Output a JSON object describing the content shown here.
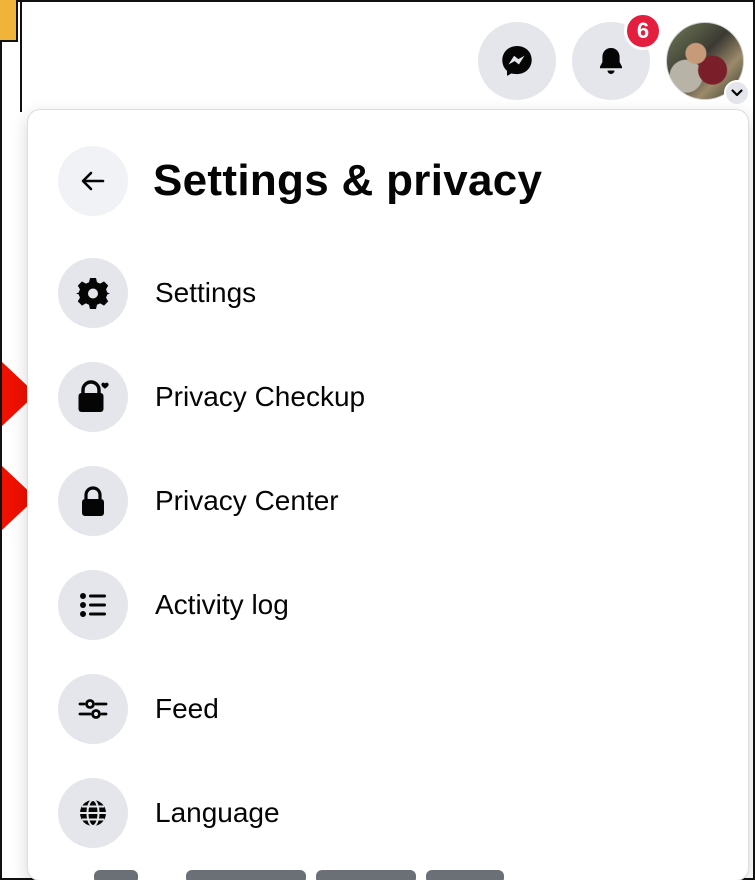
{
  "header": {
    "notification_count": "6",
    "buttons": [
      {
        "name": "messenger",
        "icon": "messenger-icon"
      },
      {
        "name": "notifications",
        "icon": "bell-icon"
      },
      {
        "name": "account",
        "icon": "chevron-down-icon"
      }
    ]
  },
  "panel": {
    "title": "Settings & privacy",
    "back_icon": "arrow-left-icon",
    "items": [
      {
        "label": "Settings",
        "icon": "gear-icon"
      },
      {
        "label": "Privacy Checkup",
        "icon": "lock-heart-icon"
      },
      {
        "label": "Privacy Center",
        "icon": "lock-icon"
      },
      {
        "label": "Activity log",
        "icon": "list-icon"
      },
      {
        "label": "Feed",
        "icon": "sliders-icon"
      },
      {
        "label": "Language",
        "icon": "globe-icon"
      }
    ]
  },
  "colors": {
    "badge": "#e41e3f",
    "icon_bg": "#e4e6eb",
    "annotation_arrow": "#ee1100"
  }
}
